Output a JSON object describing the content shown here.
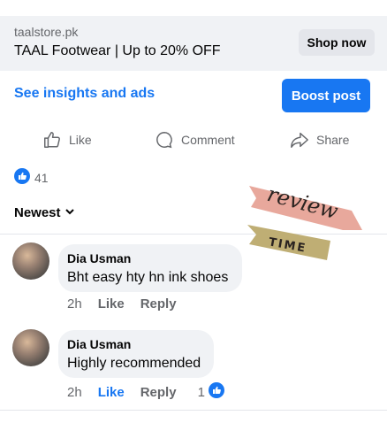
{
  "ad": {
    "domain": "taalstore.pk",
    "title": "TAAL Footwear | Up to 20% OFF",
    "cta_label": "Shop now"
  },
  "post_actions": {
    "insights_label": "See insights and ads",
    "boost_label": "Boost post",
    "like_label": "Like",
    "comment_label": "Comment",
    "share_label": "Share"
  },
  "reactions": {
    "count": "41"
  },
  "comments_sort": {
    "label": "Newest"
  },
  "comments": [
    {
      "author": "Dia Usman",
      "text": "Bht easy hty hn ink shoes",
      "time": "2h",
      "like_label": "Like",
      "reply_label": "Reply",
      "liked": false
    },
    {
      "author": "Dia Usman",
      "text": "Highly recommended",
      "time": "2h",
      "like_label": "Like",
      "reply_label": "Reply",
      "liked": true,
      "reaction_count": "1"
    }
  ],
  "sticker": {
    "line1": "review",
    "line2": "TIME"
  },
  "colors": {
    "accent": "#1877f2",
    "secondary_text": "#65676b",
    "card_bg": "#f0f2f5",
    "sticker_pink": "#e8a89c",
    "sticker_olive": "#bfae74"
  }
}
